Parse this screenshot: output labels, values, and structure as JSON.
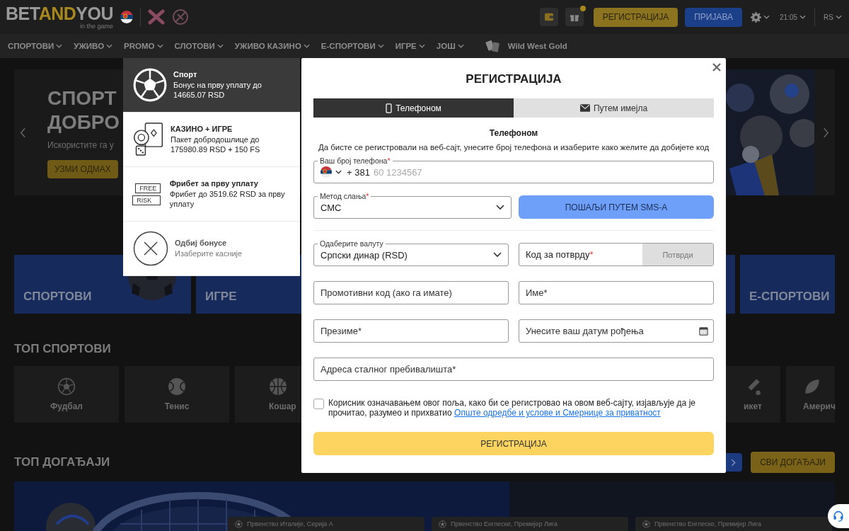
{
  "header": {
    "logo": {
      "start": "BET",
      "accent": "AND",
      "end": "YOU",
      "tagline": "in the game"
    },
    "register_button": "РЕГИСТРАЦИЈА",
    "login_button": "ПРИЈАВА",
    "time": "21:05",
    "language": "RS"
  },
  "nav": [
    {
      "label": "СПОРТОВИ",
      "has_menu": true
    },
    {
      "label": "УЖИВО",
      "has_menu": true
    },
    {
      "label": "PROMO",
      "has_menu": true
    },
    {
      "label": "СЛОТОВИ",
      "has_menu": true
    },
    {
      "label": "УЖИВО КАЗИНО",
      "has_menu": true
    },
    {
      "label": "Е-СПОРТОВИ",
      "has_menu": true
    },
    {
      "label": "ИГРЕ",
      "has_menu": true
    },
    {
      "label": "ЈОШ",
      "has_menu": true
    }
  ],
  "nav_game": {
    "label": "Wild West Gold"
  },
  "hero": {
    "title_lines": [
      "СПОРТ",
      "ДОБРО"
    ],
    "subtitle": "Искористите га у",
    "button": "УЗМИ ОДМАХ"
  },
  "categories_left": [
    {
      "label": "СПОРТОВИ"
    },
    {
      "label": "ИГРЕ"
    }
  ],
  "categories_right": [
    {
      "label": "Е-СПОРТОВИ"
    }
  ],
  "top_sports": {
    "title": "ТОП СПОРТОВИ",
    "items_left": [
      {
        "label": "Фудбал",
        "kind": "football"
      },
      {
        "label": "Тенис",
        "kind": "tennis"
      },
      {
        "label": "Кошар",
        "kind": "basketball"
      }
    ],
    "items_right": [
      {
        "label": "икет",
        "kind": "cricket"
      },
      {
        "label": "Америч",
        "kind": "american-football"
      }
    ]
  },
  "top_events": {
    "title": "ТОП ДОГАЂАЈИ",
    "all_button": "СВИ ДОГАЂАЈИ",
    "events": [
      {
        "league": "Првенство Италије, Серија А"
      },
      {
        "league": "Првенство Енглеске, Премијер Лига"
      },
      {
        "league": "Првенство Енглеске, Премијер Лига"
      }
    ]
  },
  "bonus_panel": {
    "items": [
      {
        "kind": "sport",
        "title": "Спорт",
        "description": "Бонус на прву уплату до 14665.07 RSD",
        "selected": true
      },
      {
        "kind": "casino",
        "title": "КАЗИНО + ИГРЕ",
        "description": "Пакет добродошлице до 175980.89 RSD + 150 FS",
        "selected": false
      },
      {
        "kind": "freebet",
        "title": "Фрибет за прву уплату",
        "description": "Фрибет до 3519.62 RSD за прву уплату",
        "selected": false,
        "badge_lines": [
          "FREE",
          "RISK"
        ]
      },
      {
        "kind": "decline",
        "title": "Одбиј бонусе",
        "description": "Изаберите касније",
        "selected": false
      }
    ]
  },
  "registration": {
    "title": "РЕГИСТРАЦИЈА",
    "tabs": [
      {
        "label": "Телефоном",
        "kind": "phone",
        "selected": true
      },
      {
        "label": "Путем имејла",
        "kind": "email",
        "selected": false
      }
    ],
    "section_title": "Телефоном",
    "instructions": "Да бисте се регистровали на веб-сајт, унесите број телефона и изаберите како желите да добијете код",
    "phone": {
      "label": "Ваш број телефона",
      "required_mark": "*",
      "country_code": "+ 381",
      "placeholder": "60 1234567"
    },
    "method": {
      "label": "Метод слања",
      "required_mark": "*",
      "value": "СМС"
    },
    "send_button": {
      "label": "ПОШАЉИ ПУТЕМ SMS-A",
      "disabled": true
    },
    "currency": {
      "label": "Одаберите валуту",
      "value": "Српски динар (RSD)"
    },
    "code": {
      "placeholder": "Код за потврду",
      "required_mark": "*",
      "button": "Потврди"
    },
    "fields": [
      {
        "kind": "text",
        "placeholder": "Промотивни код (ако га имате)"
      },
      {
        "kind": "text",
        "placeholder": "Име*"
      },
      {
        "kind": "text",
        "placeholder": "Презиме*"
      },
      {
        "kind": "date",
        "placeholder": "Унесите ваш датум рођења"
      }
    ],
    "address": {
      "placeholder": "Адреса сталног пребивалишта*"
    },
    "consent": {
      "checked": false,
      "text": "Корисник означавањем овог поља, како би се регистровао на овом веб-сајту, изјављује да је прочитао, разумео и прихватио ",
      "link": "Опште одредбе и услове и Смернице за приватност"
    },
    "submit": "РЕГИСТРАЦИЈА"
  }
}
